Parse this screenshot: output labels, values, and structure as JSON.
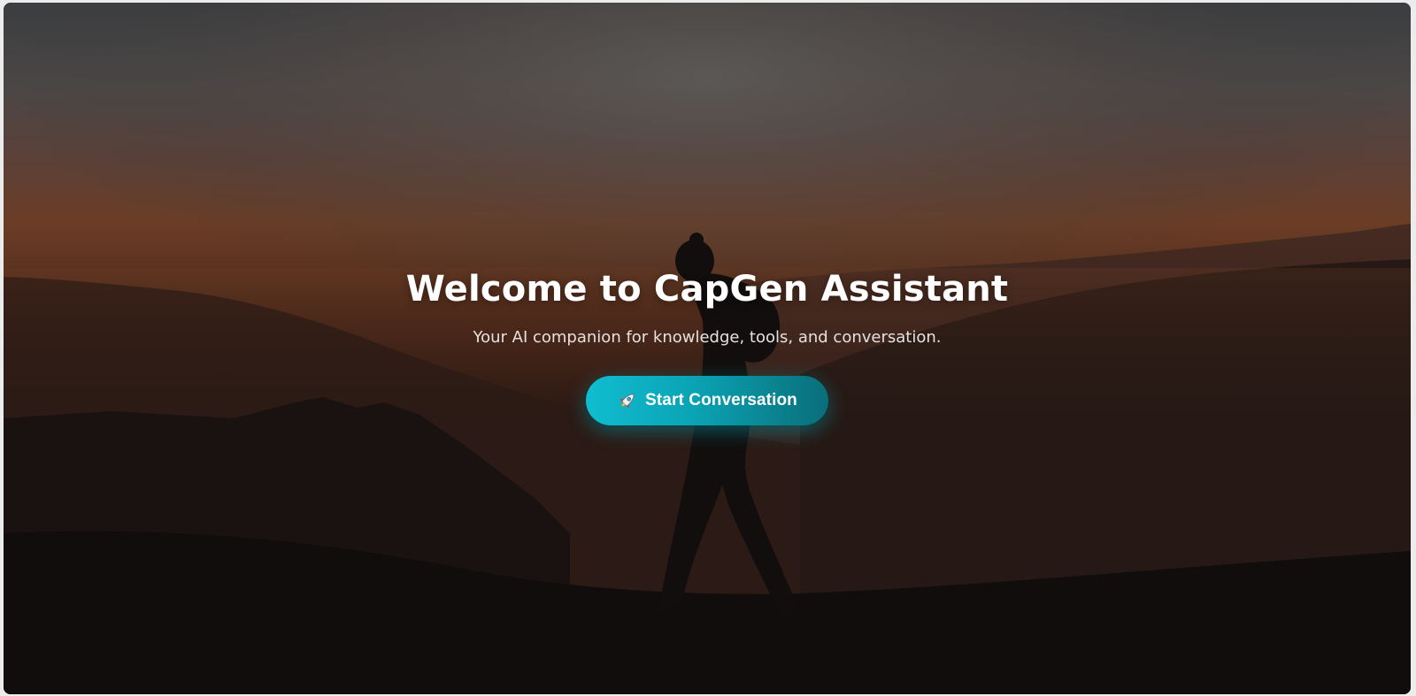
{
  "hero": {
    "title": "Welcome to CapGen Assistant",
    "subtitle": "Your AI companion for knowledge, tools, and conversation.",
    "cta_label": "Start Conversation",
    "cta_icon": "rocket-icon"
  },
  "colors": {
    "accent": "#0fb9cc",
    "accent_dark": "#0a6e79",
    "text": "#ffffff"
  }
}
